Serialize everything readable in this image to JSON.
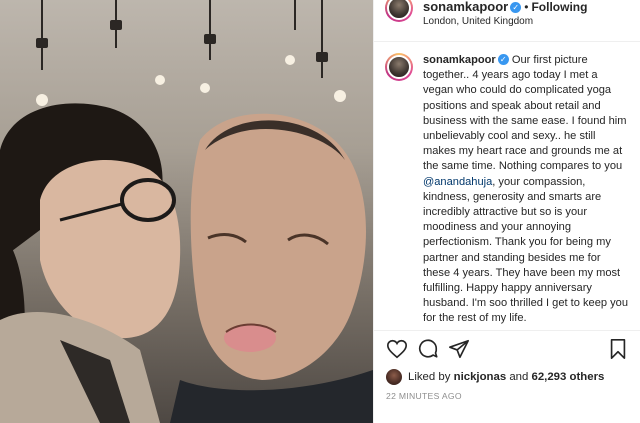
{
  "post": {
    "username": "sonamkapoor",
    "follow_separator": "•",
    "follow_status": "Following",
    "location": "London, United Kingdom",
    "caption_text": "Our first picture together.. 4 years ago today I met a vegan who could do complicated yoga positions and speak about retail and business with the same ease. I found him unbelievably cool and sexy.. he still makes my heart race and grounds me at the same time. Nothing compares to you",
    "caption_mention": "@anandahuja",
    "caption_rest": ", your compassion, kindness, generosity and smarts are incredibly attractive but so is your moodiness and your annoying perfectionism. Thank you for being my partner and standing besides me for these 4 years. They have been my most fulfilling. Happy happy anniversary husband. I'm soo thrilled I get to keep you for the rest of my life.",
    "likes_prefix": "Liked by",
    "liked_by_user": "nickjonas",
    "likes_joiner": "and",
    "likes_count": "62,293 others",
    "timestamp": "22 MINUTES AGO"
  },
  "icons": {
    "verified": "verified-badge",
    "like": "heart-icon",
    "comment": "comment-icon",
    "share": "share-icon",
    "save": "bookmark-icon"
  }
}
